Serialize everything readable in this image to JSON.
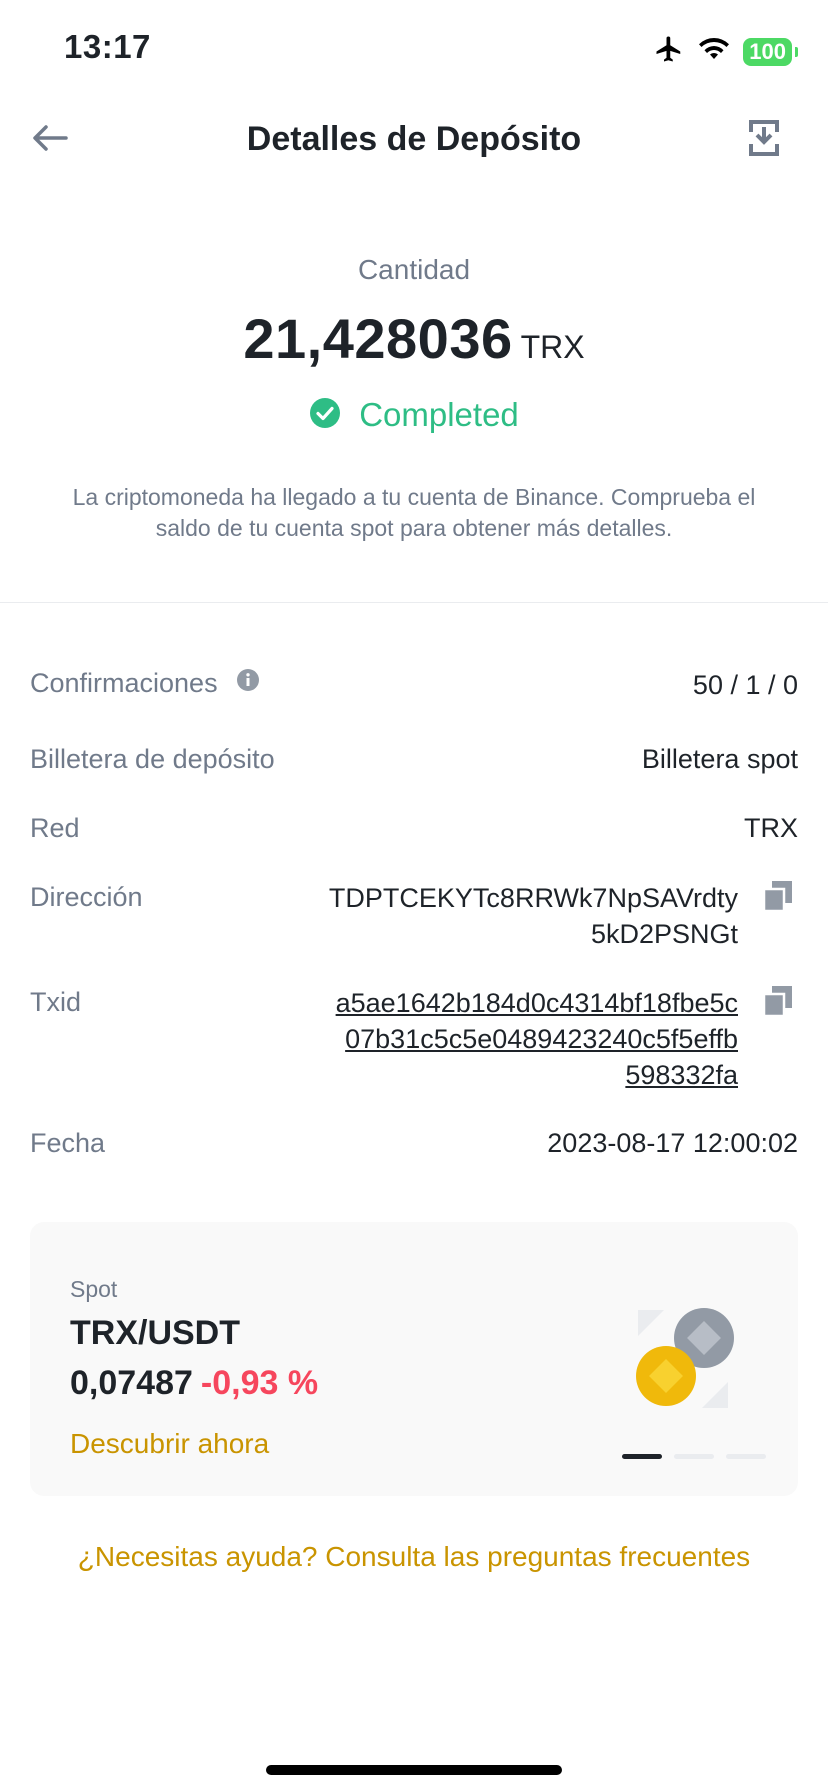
{
  "status_bar": {
    "time": "13:17",
    "battery": "100"
  },
  "header": {
    "title": "Detalles de Depósito"
  },
  "amount": {
    "label": "Cantidad",
    "value": "21,428036",
    "unit": "TRX",
    "status": "Completed",
    "message": "La criptomoneda ha llegado a tu cuenta de Binance. Comprueba el saldo de tu cuenta spot para obtener más detalles."
  },
  "details": {
    "confirmations": {
      "label": "Confirmaciones",
      "value": "50 / 1 / 0"
    },
    "wallet": {
      "label": "Billetera de depósito",
      "value": "Billetera spot"
    },
    "network": {
      "label": "Red",
      "value": "TRX"
    },
    "address": {
      "label": "Dirección",
      "lines": [
        "TDPTCEKYTc8RRWk7NpSAVrdty",
        "5kD2PSNGt"
      ]
    },
    "txid": {
      "label": "Txid",
      "lines": [
        "a5ae1642b184d0c4314bf18fbe5c",
        "07b31c5c5e0489423240c5f5effb",
        "598332fa"
      ]
    },
    "date": {
      "label": "Fecha",
      "value": "2023-08-17 12:00:02"
    }
  },
  "promo": {
    "tag": "Spot",
    "pair": "TRX/USDT",
    "price": "0,07487",
    "change": "-0,93 %",
    "cta": "Descubrir ahora",
    "carousel_active": 1,
    "carousel_count": 3
  },
  "help_link": "¿Necesitas ayuda? Consulta las preguntas frecuentes",
  "colors": {
    "success": "#2ebd85",
    "negative": "#f6465d",
    "accent": "#c99400",
    "muted": "#707a8a",
    "text": "#1e2329"
  },
  "icons": {
    "back": "arrow-left-icon",
    "download": "download-icon",
    "status": "check-circle-icon",
    "info": "info-icon",
    "copy": "copy-icon"
  }
}
